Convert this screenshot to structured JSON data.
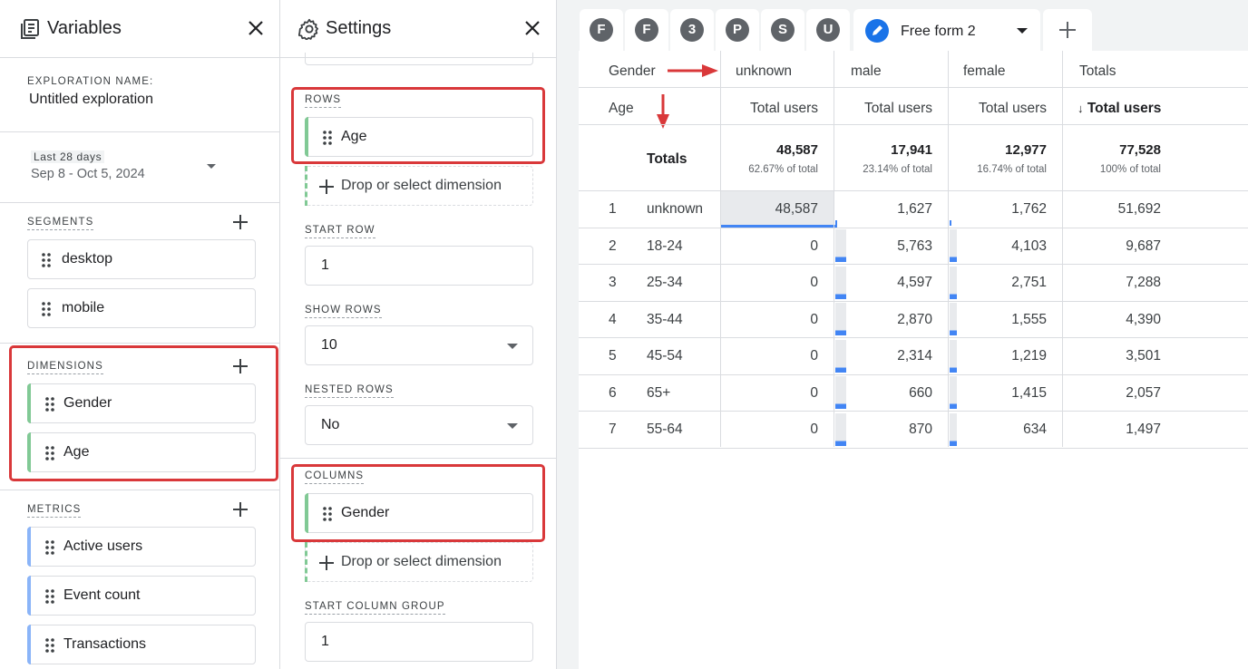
{
  "variables": {
    "title": "Variables",
    "exploration_label": "EXPLORATION NAME:",
    "exploration_name": "Untitled exploration",
    "date_range_label": "Last 28 days",
    "date_range_value": "Sep 8 - Oct 5, 2024",
    "segments_label": "SEGMENTS",
    "segments": [
      "desktop",
      "mobile"
    ],
    "dimensions_label": "DIMENSIONS",
    "dimensions": [
      "Gender",
      "Age"
    ],
    "metrics_label": "METRICS",
    "metrics": [
      "Active users",
      "Event count",
      "Transactions"
    ]
  },
  "settings": {
    "title": "Settings",
    "rows_label": "ROWS",
    "rows_value": "Age",
    "drop_text": "Drop or select dimension",
    "start_row_label": "START ROW",
    "start_row_value": "1",
    "show_rows_label": "SHOW ROWS",
    "show_rows_value": "10",
    "nested_rows_label": "NESTED ROWS",
    "nested_rows_value": "No",
    "columns_label": "COLUMNS",
    "columns_value": "Gender",
    "drop_text_2": "Drop or select dimension",
    "start_column_group_label": "START COLUMN GROUP",
    "start_column_group_value": "1"
  },
  "tabs": {
    "letters": [
      "F",
      "F",
      "3",
      "P",
      "S",
      "U"
    ],
    "active_label": "Free form 2"
  },
  "table": {
    "col_dim_label": "Gender",
    "row_dim_label": "Age",
    "columns": [
      "unknown",
      "male",
      "female",
      "Totals"
    ],
    "metric_label": "Total users",
    "sort_arrow": "↓",
    "totals_label": "Totals",
    "totals": [
      "48,587",
      "17,941",
      "12,977",
      "77,528"
    ],
    "totals_pct": [
      "62.67% of total",
      "23.14% of total",
      "16.74% of total",
      "100% of total"
    ],
    "rows": [
      {
        "idx": "1",
        "age": "unknown",
        "values": [
          "48,587",
          "1,627",
          "1,762",
          "51,692"
        ]
      },
      {
        "idx": "2",
        "age": "18-24",
        "values": [
          "0",
          "5,763",
          "4,103",
          "9,687"
        ]
      },
      {
        "idx": "3",
        "age": "25-34",
        "values": [
          "0",
          "4,597",
          "2,751",
          "7,288"
        ]
      },
      {
        "idx": "4",
        "age": "35-44",
        "values": [
          "0",
          "2,870",
          "1,555",
          "4,390"
        ]
      },
      {
        "idx": "5",
        "age": "45-54",
        "values": [
          "0",
          "2,314",
          "1,219",
          "3,501"
        ]
      },
      {
        "idx": "6",
        "age": "65+",
        "values": [
          "0",
          "660",
          "1,415",
          "2,057"
        ]
      },
      {
        "idx": "7",
        "age": "55-64",
        "values": [
          "0",
          "870",
          "634",
          "1,497"
        ]
      }
    ]
  },
  "colors": {
    "dimension_bar": "#81c995",
    "metric_bar": "#8ab4f8",
    "highlight": "#d9383a",
    "accent": "#1a73e8"
  }
}
